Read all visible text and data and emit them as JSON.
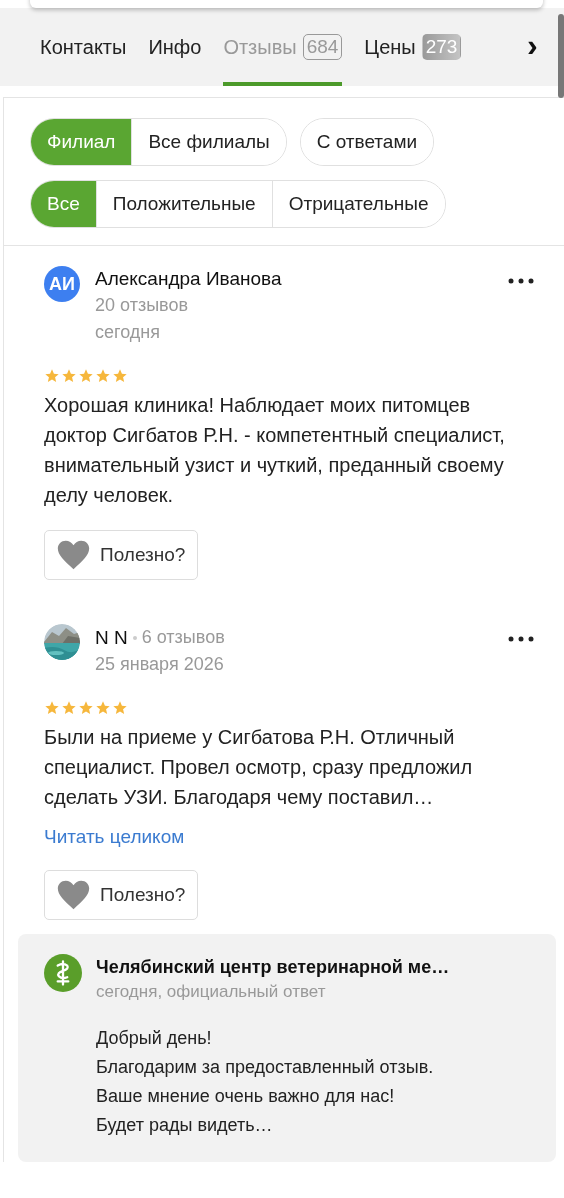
{
  "tabs": [
    {
      "label": "Контакты",
      "selected": false
    },
    {
      "label": "Инфо",
      "selected": false
    },
    {
      "label": "Отзывы",
      "count": "684",
      "selected": true
    },
    {
      "label": "Цены",
      "count": "273",
      "selected": false
    }
  ],
  "tabs_more": "›",
  "filters": [
    [
      {
        "label": "Филиал",
        "selected": true
      },
      {
        "label": "Все филиалы",
        "selected": false
      }
    ],
    [
      {
        "label": "С ответами",
        "selected": false
      }
    ],
    [
      {
        "label": "Все",
        "selected": true
      },
      {
        "label": "Положительные",
        "selected": false
      },
      {
        "label": "Отрицательные",
        "selected": false
      }
    ]
  ],
  "reviews": [
    {
      "author": {
        "name": "Александра Иванова",
        "avatar": {
          "kind": "initials",
          "text": "АИ",
          "color": "#3d7ff0"
        },
        "reviews_count": "20 отзывов",
        "inline_count": false
      },
      "date": "сегодня",
      "stars": 5,
      "text": "Хорошая клиника! Наблюдает моих питомцев доктор Сигбатов Р.Н. - компетентный специалист, внимательный узист и чуткий, преданный своему делу человек.",
      "helpful": "Полезно?"
    },
    {
      "author": {
        "name": "N N",
        "reviews_count": "6 отзывов",
        "inline_count": true
      },
      "date": "25 января 2026",
      "stars": 5,
      "text": "Были на приеме у Сигбатова Р.Н. Отличный специалист. Провел осмотр, сразу предложил сделать УЗИ. Благодаря чему поставил…",
      "read_more": "Читать целиком",
      "helpful": "Полезно?",
      "reply": {
        "name": "Челябинский центр ветеринарной ме…",
        "meta": "сегодня, официальный ответ",
        "lines": [
          "Добрый день!",
          "Благодарим за предоставленный отзыв.",
          "Ваше мнение очень важно для нас!",
          "Будет рады видеть…"
        ]
      }
    }
  ]
}
